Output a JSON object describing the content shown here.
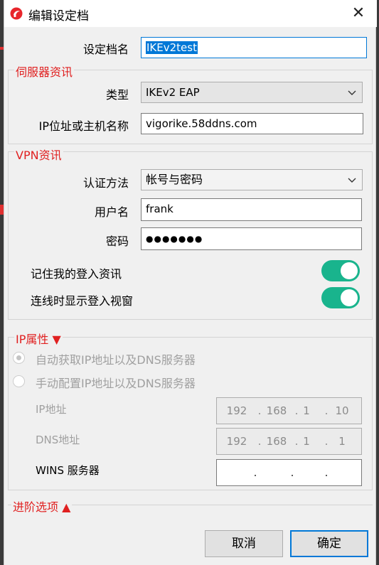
{
  "window": {
    "title": "编辑设定档",
    "close_glyph": "✕"
  },
  "profile": {
    "label": "设定档名",
    "value": "IKEv2test"
  },
  "server": {
    "section_title": "伺服器资讯",
    "type_label": "类型",
    "type_value": "IKEv2 EAP",
    "host_label": "IP位址或主机名称",
    "host_value": "vigorike.58ddns.com"
  },
  "vpn": {
    "section_title": "VPN资讯",
    "auth_label": "认证方法",
    "auth_value": "帐号与密码",
    "username_label": "用户名",
    "username_value": "frank",
    "password_label": "密码",
    "password_value": "●●●●●●●",
    "remember_label": "记住我的登入资讯",
    "remember_on": true,
    "show_window_label": "连线时显示登入视窗",
    "show_window_on": true
  },
  "ip": {
    "section_title": "IP属性 ▼",
    "auto_label": "自动获取IP地址以及DNS服务器",
    "manual_label": "手动配置IP地址以及DNS服务器",
    "ip_label": "IP地址",
    "ip_octets": [
      "192",
      "168",
      "1",
      "10"
    ],
    "dns_label": "DNS地址",
    "dns_octets": [
      "192",
      "168",
      "1",
      "1"
    ],
    "wins_label": "WINS 服务器",
    "wins_octets": [
      "",
      "",
      "",
      ""
    ],
    "separator": "."
  },
  "advanced": {
    "title": "进阶选项 ▲"
  },
  "buttons": {
    "cancel": "取消",
    "ok": "确定"
  },
  "colors": {
    "accent": "#0078d7",
    "toggle_on": "#19b48d",
    "section_title": "#e02020"
  },
  "icons": {
    "app": "app-logo-icon",
    "dropdown": "chevron-down-icon",
    "close": "close-icon"
  }
}
